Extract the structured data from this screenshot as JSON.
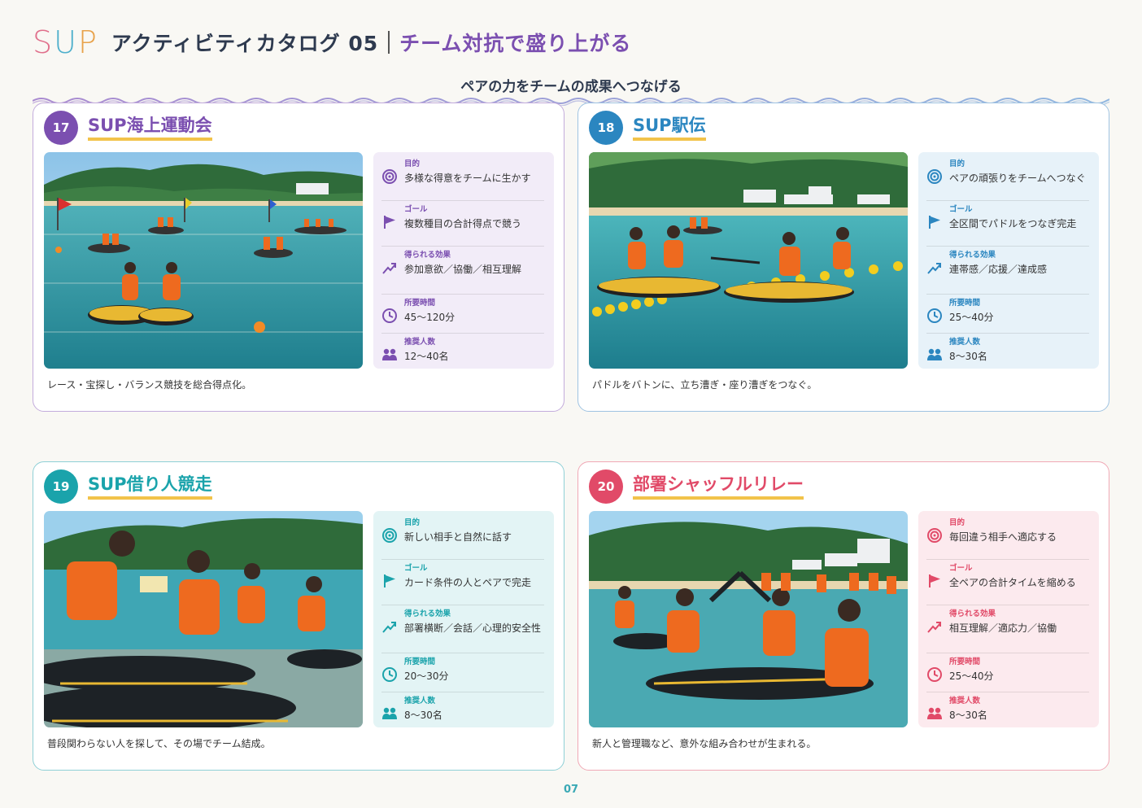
{
  "header": {
    "logo": [
      "S",
      "U",
      "P"
    ],
    "title": "アクティビティカタログ 05",
    "subtitle": "チーム対抗で盛り上がる"
  },
  "tagline": "ペアの力をチームの成果へつなげる",
  "labels": {
    "purpose": "目的",
    "goal": "ゴール",
    "effect": "得られる効果",
    "time": "所要時間",
    "people": "推奨人数"
  },
  "colors": {
    "purple": "#7b4fb0",
    "blue": "#2b86c0",
    "teal": "#1aa3ab",
    "pink": "#e14a68",
    "yellow_underline": "#f2c34a"
  },
  "icons": [
    "target-icon",
    "flag-icon",
    "trend-up-icon",
    "clock-icon",
    "people-icon"
  ],
  "cards": [
    {
      "num": "17",
      "title": "SUP海上運動会",
      "purpose": "多様な得意をチームに生かす",
      "goal": "複数種目の合計得点で競う",
      "effect": "参加意欲／協働／相互理解",
      "time": "45〜120分",
      "people": "12〜40名",
      "desc": "レース・宝探し・バランス競技を総合得点化。"
    },
    {
      "num": "18",
      "title": "SUP駅伝",
      "purpose": "ペアの頑張りをチームへつなぐ",
      "goal": "全区間でパドルをつなぎ完走",
      "effect": "連帯感／応援／達成感",
      "time": "25〜40分",
      "people": "8〜30名",
      "desc": "パドルをバトンに、立ち漕ぎ・座り漕ぎをつなぐ。"
    },
    {
      "num": "19",
      "title": "SUP借り人競走",
      "purpose": "新しい相手と自然に話す",
      "goal": "カード条件の人とペアで完走",
      "effect": "部署横断／会話／心理的安全性",
      "time": "20〜30分",
      "people": "8〜30名",
      "desc": "普段関わらない人を探して、その場でチーム結成。"
    },
    {
      "num": "20",
      "title": "部署シャッフルリレー",
      "purpose": "毎回違う相手へ適応する",
      "goal": "全ペアの合計タイムを縮める",
      "effect": "相互理解／適応力／協働",
      "time": "25〜40分",
      "people": "8〜30名",
      "desc": "新人と管理職など、意外な組み合わせが生まれる。"
    }
  ],
  "page_number": "07"
}
